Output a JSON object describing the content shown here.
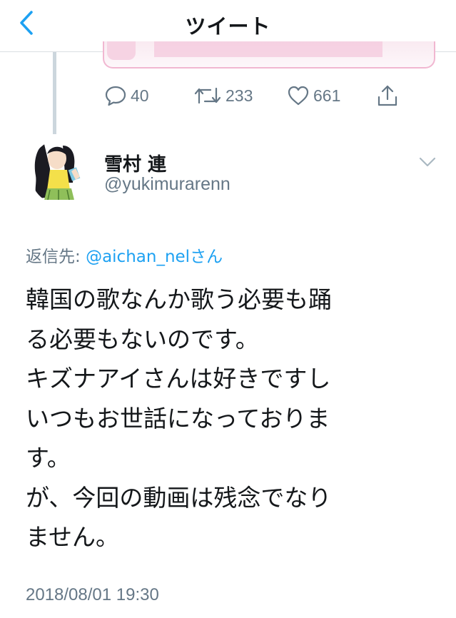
{
  "header": {
    "title": "ツイート"
  },
  "prev_tweet": {
    "stats": {
      "replies": "40",
      "retweets": "233",
      "likes": "661"
    }
  },
  "tweet": {
    "display_name": "雪村 連",
    "handle": "@yukimurarenn",
    "reply_prefix": "返信先: ",
    "reply_mention": "@aichan_nel",
    "reply_suffix": "さん",
    "body_lines": [
      "韓国の歌なんか歌う必要も踊",
      "る必要もないのです。",
      "キズナアイさんは好きですし",
      "いつもお世話になっておりま",
      "す。",
      "が、今回の動画は残念でなり",
      "ません。"
    ],
    "timestamp": "2018/08/01 19:30"
  },
  "icons": {
    "back": "chevron-left-icon",
    "reply": "speech-bubble-icon",
    "retweet": "retweet-arrows-icon",
    "like": "heart-icon",
    "share": "share-upload-icon",
    "more": "chevron-down-icon"
  },
  "colors": {
    "accent": "#1da1f2",
    "secondary_text": "#657786",
    "primary_text": "#14171a",
    "thread_line": "#ccd6dd"
  }
}
